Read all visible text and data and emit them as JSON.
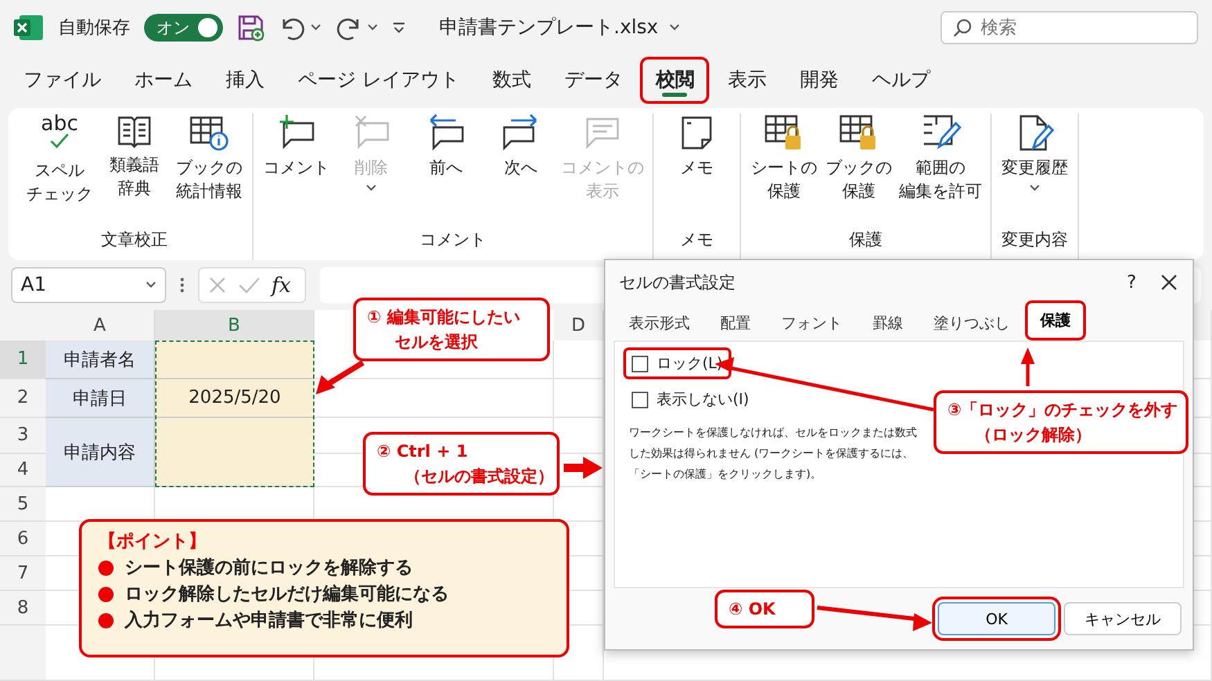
{
  "titlebar": {
    "autosave_label": "自動保存",
    "toggle": {
      "label": "オン",
      "on": true
    },
    "filename": "申請書テンプレート.xlsx",
    "search": {
      "placeholder": "検索"
    }
  },
  "menu_tabs": [
    {
      "label": "ファイル",
      "selected": false,
      "highlighted": false
    },
    {
      "label": "ホーム",
      "selected": false,
      "highlighted": false
    },
    {
      "label": "挿入",
      "selected": false,
      "highlighted": false
    },
    {
      "label": "ページ レイアウト",
      "selected": false,
      "highlighted": false
    },
    {
      "label": "数式",
      "selected": false,
      "highlighted": false
    },
    {
      "label": "データ",
      "selected": false,
      "highlighted": false
    },
    {
      "label": "校閲",
      "selected": true,
      "highlighted": true
    },
    {
      "label": "表示",
      "selected": false,
      "highlighted": false
    },
    {
      "label": "開発",
      "selected": false,
      "highlighted": false
    },
    {
      "label": "ヘルプ",
      "selected": false,
      "highlighted": false
    }
  ],
  "ribbon": {
    "groups": [
      {
        "label": "文章校正",
        "buttons": [
          {
            "lines": [
              "スペル",
              "チェック"
            ],
            "icon_text": "abc",
            "disabled": false,
            "dropdown": false
          },
          {
            "lines": [
              "類義語",
              "辞典"
            ],
            "disabled": false,
            "dropdown": false
          },
          {
            "lines": [
              "ブックの",
              "統計情報"
            ],
            "disabled": false,
            "dropdown": false
          }
        ]
      },
      {
        "label": "コメント",
        "buttons": [
          {
            "lines": [
              "コメント"
            ],
            "disabled": false,
            "dropdown": false
          },
          {
            "lines": [
              "削除"
            ],
            "disabled": true,
            "dropdown": true
          },
          {
            "lines": [
              "前へ"
            ],
            "disabled": false,
            "dropdown": false
          },
          {
            "lines": [
              "次へ"
            ],
            "disabled": false,
            "dropdown": false
          },
          {
            "lines": [
              "コメントの",
              "表示"
            ],
            "disabled": true,
            "dropdown": false
          }
        ]
      },
      {
        "label": "メモ",
        "buttons": [
          {
            "lines": [
              "メモ"
            ],
            "disabled": false,
            "dropdown": false
          }
        ]
      },
      {
        "label": "保護",
        "buttons": [
          {
            "lines": [
              "シートの",
              "保護"
            ],
            "disabled": false,
            "dropdown": false
          },
          {
            "lines": [
              "ブックの",
              "保護"
            ],
            "disabled": false,
            "dropdown": false
          },
          {
            "lines": [
              "範囲の",
              "編集を許可"
            ],
            "disabled": false,
            "dropdown": false
          }
        ]
      },
      {
        "label": "変更内容",
        "buttons": [
          {
            "lines": [
              "変更履歴"
            ],
            "disabled": false,
            "dropdown": true
          }
        ]
      }
    ]
  },
  "formula_bar": {
    "name_box": "A1",
    "fx": "fx"
  },
  "sheet": {
    "columns": [
      {
        "label": "A",
        "selected": false
      },
      {
        "label": "B",
        "selected": true
      },
      {
        "label": "D",
        "selected": false
      }
    ],
    "rows": [
      {
        "label": "1",
        "selected": true
      },
      {
        "label": "2",
        "selected": false
      },
      {
        "label": "3",
        "selected": false
      },
      {
        "label": "4",
        "selected": false
      },
      {
        "label": "5",
        "selected": false
      },
      {
        "label": "6",
        "selected": false
      },
      {
        "label": "7",
        "selected": false
      },
      {
        "label": "8",
        "selected": false
      }
    ],
    "form_rows": [
      {
        "label": "申請者名"
      },
      {
        "label": "申請日",
        "value": "2025/5/20"
      },
      {
        "label": "申請内容"
      }
    ]
  },
  "dialog": {
    "title": "セルの書式設定",
    "help": "?",
    "tabs": [
      {
        "label": "表示形式",
        "selected": false,
        "highlighted": false
      },
      {
        "label": "配置",
        "selected": false,
        "highlighted": false
      },
      {
        "label": "フォント",
        "selected": false,
        "highlighted": false
      },
      {
        "label": "罫線",
        "selected": false,
        "highlighted": false
      },
      {
        "label": "塗りつぶし",
        "selected": false,
        "highlighted": false
      },
      {
        "label": "保護",
        "selected": true,
        "highlighted": true
      }
    ],
    "checkboxes": [
      {
        "label": "ロック(L)",
        "checked": false,
        "highlighted": true
      },
      {
        "label": "表示しない(I)",
        "checked": false,
        "highlighted": false
      }
    ],
    "description_lines": [
      "ワークシートを保護しなければ、セルをロックまたは数式",
      "した効果は得られません (ワークシートを保護するには、",
      "「シートの保護」をクリックします)。"
    ],
    "buttons": [
      {
        "label": "OK",
        "highlighted": true
      },
      {
        "label": "キャンセル",
        "highlighted": false
      }
    ]
  },
  "callouts": [
    {
      "lines": [
        "① 編集可能にしたい",
        "セルを選択"
      ]
    },
    {
      "lines": [
        "② Ctrl + 1",
        "（セルの書式設定）"
      ]
    },
    {
      "lines": [
        "③「ロック」のチェックを外す",
        "（ロック解除）"
      ]
    },
    {
      "lines": [
        "④ OK"
      ]
    }
  ],
  "point_box": {
    "title": "【ポイント】",
    "items": [
      "シート保護の前にロックを解除する",
      "ロック解除したセルだけ編集可能になる",
      "入力フォームや申請書で非常に便利"
    ]
  }
}
